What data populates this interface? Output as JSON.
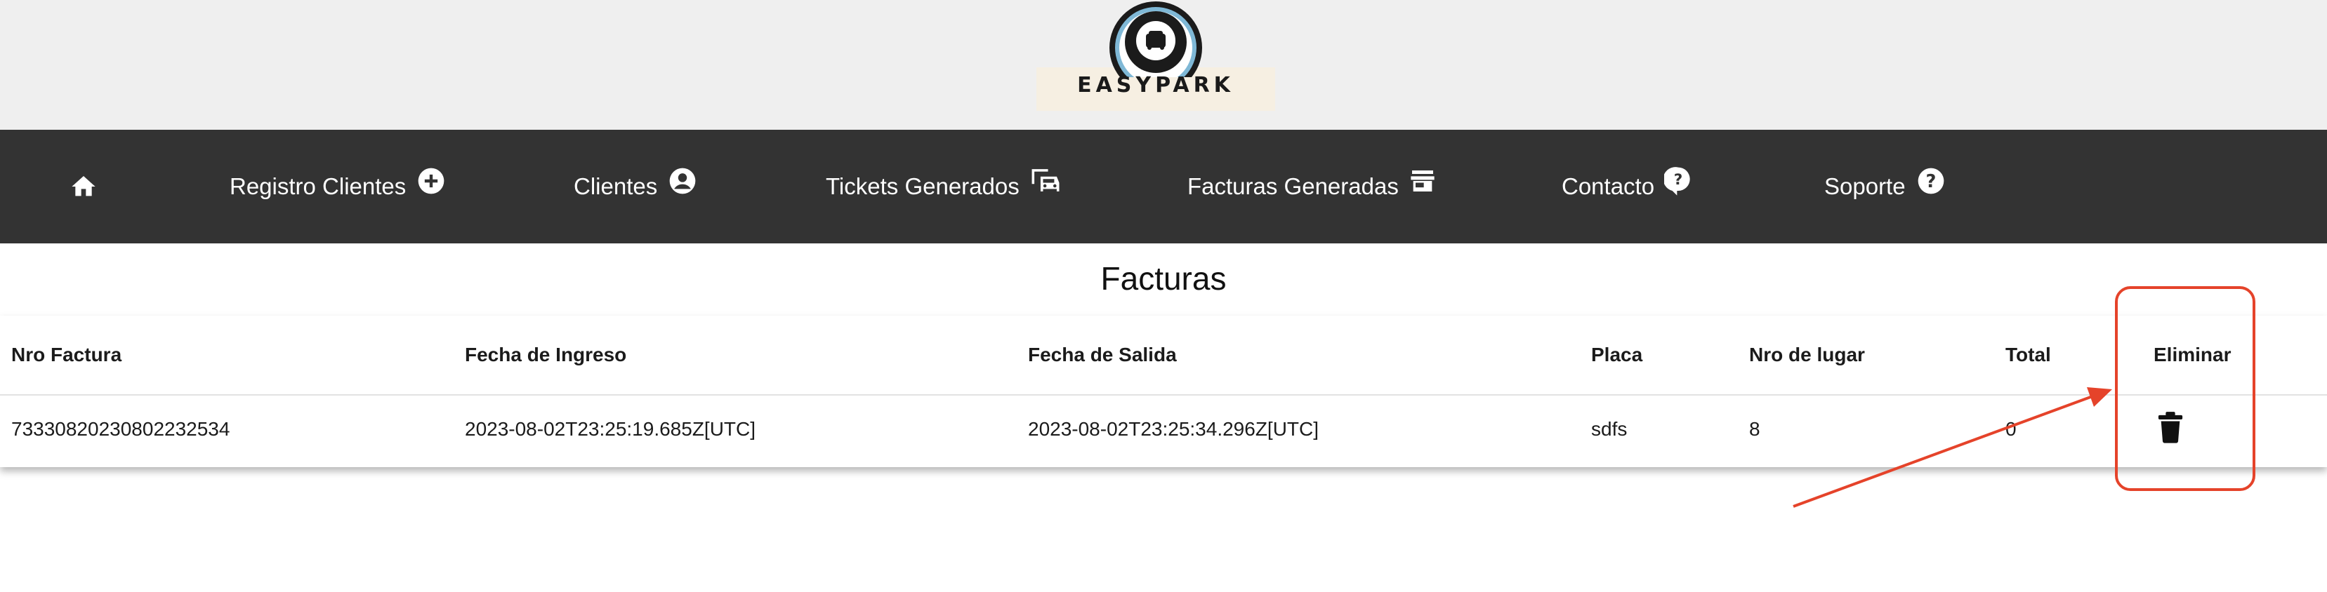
{
  "brand": {
    "name": "EASYPARK"
  },
  "nav": {
    "items": [
      {
        "label": "",
        "icon": "home-icon"
      },
      {
        "label": "Registro Clientes",
        "icon": "add-circle-icon"
      },
      {
        "label": "Clientes",
        "icon": "account-circle-icon"
      },
      {
        "label": "Tickets Generados",
        "icon": "vehicles-icon"
      },
      {
        "label": "Facturas Generadas",
        "icon": "store-icon"
      },
      {
        "label": "Contacto",
        "icon": "help-chat-icon"
      },
      {
        "label": "Soporte",
        "icon": "help-circle-icon"
      }
    ]
  },
  "page": {
    "title": "Facturas"
  },
  "table": {
    "columns": [
      "Nro Factura",
      "Fecha de Ingreso",
      "Fecha de Salida",
      "Placa",
      "Nro de lugar",
      "Total",
      "Eliminar"
    ],
    "rows": [
      {
        "nro_factura": "73330820230802232534",
        "fecha_ingreso": "2023-08-02T23:25:19.685Z[UTC]",
        "fecha_salida": "2023-08-02T23:25:34.296Z[UTC]",
        "placa": "sdfs",
        "nro_lugar": "8",
        "total": "0",
        "delete_icon": "trash-icon"
      }
    ]
  },
  "colors": {
    "navbar": "#333333",
    "top_band": "#efefef",
    "annotation": "#e5432a"
  }
}
